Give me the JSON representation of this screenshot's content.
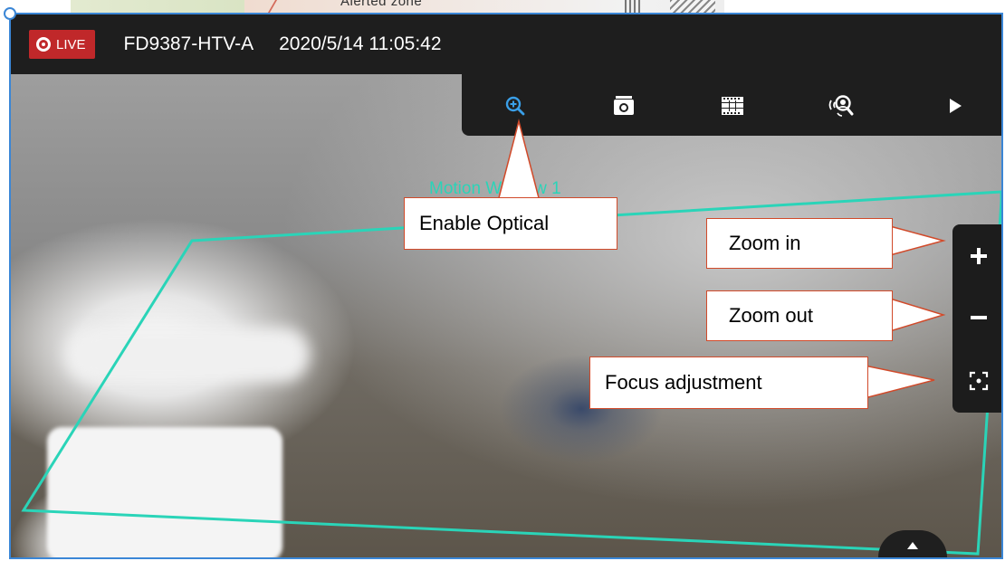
{
  "map_strip": {
    "text": "Alerted zone"
  },
  "viewer": {
    "live_badge": "LIVE",
    "camera_name": "FD9387-HTV-A",
    "timestamp": "2020/5/14 11:05:42",
    "motion_window_label": "Motion Window 1"
  },
  "toolbar": {
    "items": [
      {
        "icon": "zoom-magnifier-icon",
        "label": "Enable Optical"
      },
      {
        "icon": "camera-snapshot-icon"
      },
      {
        "icon": "film-grid-icon"
      },
      {
        "icon": "alarm-search-icon"
      },
      {
        "icon": "play-icon"
      }
    ]
  },
  "zoom_panel": {
    "zoom_in": "+",
    "zoom_out": "−"
  },
  "callouts": {
    "enable_optical": "Enable Optical",
    "zoom_in": "Zoom in",
    "zoom_out": "Zoom out",
    "focus_adjustment": "Focus adjustment"
  },
  "colors": {
    "accent_blue": "#3a86d6",
    "live_red": "#c0282a",
    "motion_teal": "#2ad4b8",
    "callout_border": "#d14a2a"
  }
}
